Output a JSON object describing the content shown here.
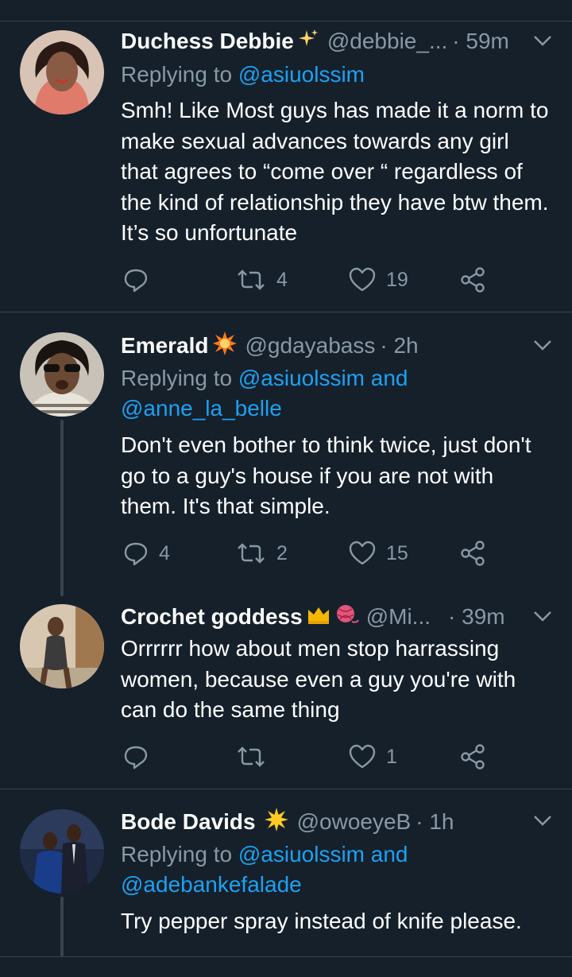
{
  "colors": {
    "background": "#15202b",
    "divider": "#38444d",
    "muted": "#8899a6",
    "link": "#1da1f2"
  },
  "tweets": [
    {
      "name": "Duchess Debbie",
      "name_emoji": "sparkles",
      "handle": "@debbie_...",
      "time": "· 59m",
      "replying_prefix": "Replying to ",
      "replying_to": "@asiuolssim",
      "text": "Smh! Like Most guys has made it a norm to make sexual advances towards any girl that agrees to “come over “ regardless of the kind of relationship they have btw them. It’s so unfortunate",
      "replies": "",
      "retweets": "4",
      "likes": "19"
    },
    {
      "name": "Emerald",
      "name_emoji": "collision",
      "handle": "@gdayabass",
      "time": "· 2h",
      "replying_prefix": "Replying to ",
      "replying_to": "@asiuolssim and @anne_la_belle",
      "text": "Don't even bother to think twice, just don't go to a guy's house if you are not with them. It's that simple.",
      "replies": "4",
      "retweets": "2",
      "likes": "15"
    },
    {
      "name": "Crochet goddess",
      "name_emoji": "crown-yarn",
      "handle": "@Mi...",
      "time": "· 39m",
      "text": "Orrrrrr how about  men stop harrassing women, because even a guy you're with can do the same thing",
      "replies": "",
      "retweets": "",
      "likes": "1"
    },
    {
      "name": "Bode Davids",
      "name_emoji": "star",
      "handle": "@owoeyeB",
      "time": "· 1h",
      "replying_prefix": "Replying to ",
      "replying_to": "@asiuolssim and @adebankefalade",
      "text": "Try pepper spray instead of knife please."
    }
  ]
}
